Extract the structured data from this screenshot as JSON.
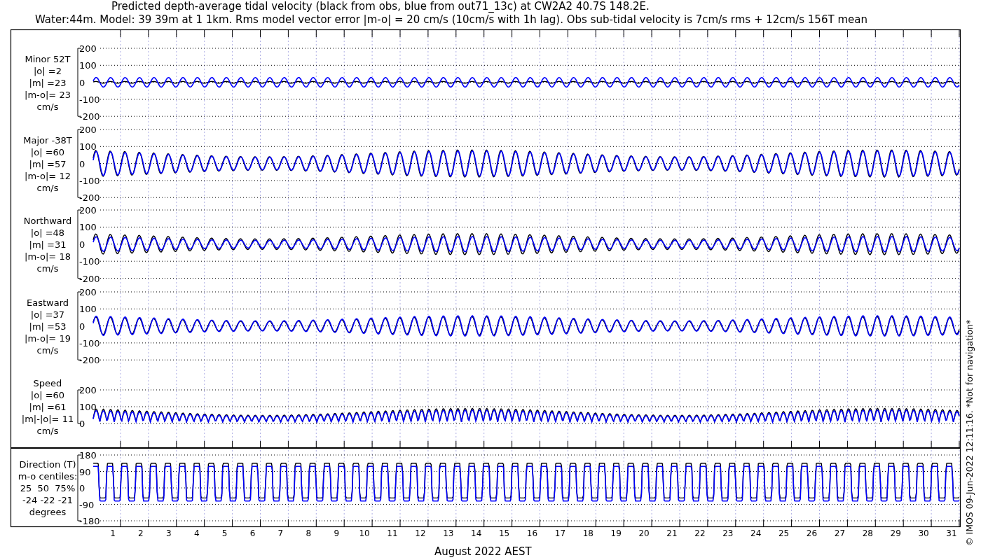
{
  "title_lines": [
    "Predicted depth-average tidal velocity (black from obs, blue from out71_13c) at CW2A2 40.7S 148.2E.",
    "Water:44m. Model: 39 39m at 1 1km. Rms model vector error |m-o| = 20 cm/s (10cm/s with 1h lag). Obs sub-tidal velocity is 7cm/s rms + 12cm/s 156T mean"
  ],
  "panels": [
    {
      "kind": "signed",
      "label_lines": [
        "Minor 52T",
        "|o| =2",
        "|m| =23",
        "|m-o|= 23",
        "cm/s"
      ],
      "yticks": [
        "200",
        "100",
        "0",
        "-100",
        "-200"
      ]
    },
    {
      "kind": "signed",
      "label_lines": [
        "Major -38T",
        "|o| =60",
        "|m| =57",
        "|m-o|= 12",
        "cm/s"
      ],
      "yticks": [
        "200",
        "100",
        "0",
        "-100",
        "-200"
      ]
    },
    {
      "kind": "signed",
      "label_lines": [
        "Northward",
        "|o| =48",
        "|m| =31",
        "|m-o|= 18",
        "cm/s"
      ],
      "yticks": [
        "200",
        "100",
        "0",
        "-100",
        "-200"
      ]
    },
    {
      "kind": "signed",
      "label_lines": [
        "Eastward",
        "|o| =37",
        "|m| =53",
        "|m-o|= 19",
        "cm/s"
      ],
      "yticks": [
        "200",
        "100",
        "0",
        "-100",
        "-200"
      ]
    },
    {
      "kind": "speed",
      "label_lines": [
        "Speed",
        "|o| =60",
        "|m| =61",
        "|m|-|o|= 11",
        "cm/s"
      ],
      "yticks": [
        "200",
        "100",
        "0"
      ]
    },
    {
      "kind": "direction",
      "label_lines": [
        "Direction (T)",
        "m-o centiles:",
        "25  50  75%",
        "-24 -22 -21",
        "degrees"
      ],
      "yticks": [
        "180",
        "90",
        "0",
        "-90",
        "-180"
      ]
    }
  ],
  "xticks": [
    "1",
    "2",
    "3",
    "4",
    "5",
    "6",
    "7",
    "8",
    "9",
    "10",
    "11",
    "12",
    "13",
    "14",
    "15",
    "16",
    "17",
    "18",
    "19",
    "20",
    "21",
    "22",
    "23",
    "24",
    "25",
    "26",
    "27",
    "28",
    "29",
    "30",
    "31"
  ],
  "xlabel": "August 2022 AEST",
  "side_note": "© IMOS 09-Jun-2022 12:11:16. *Not for navigation*"
}
